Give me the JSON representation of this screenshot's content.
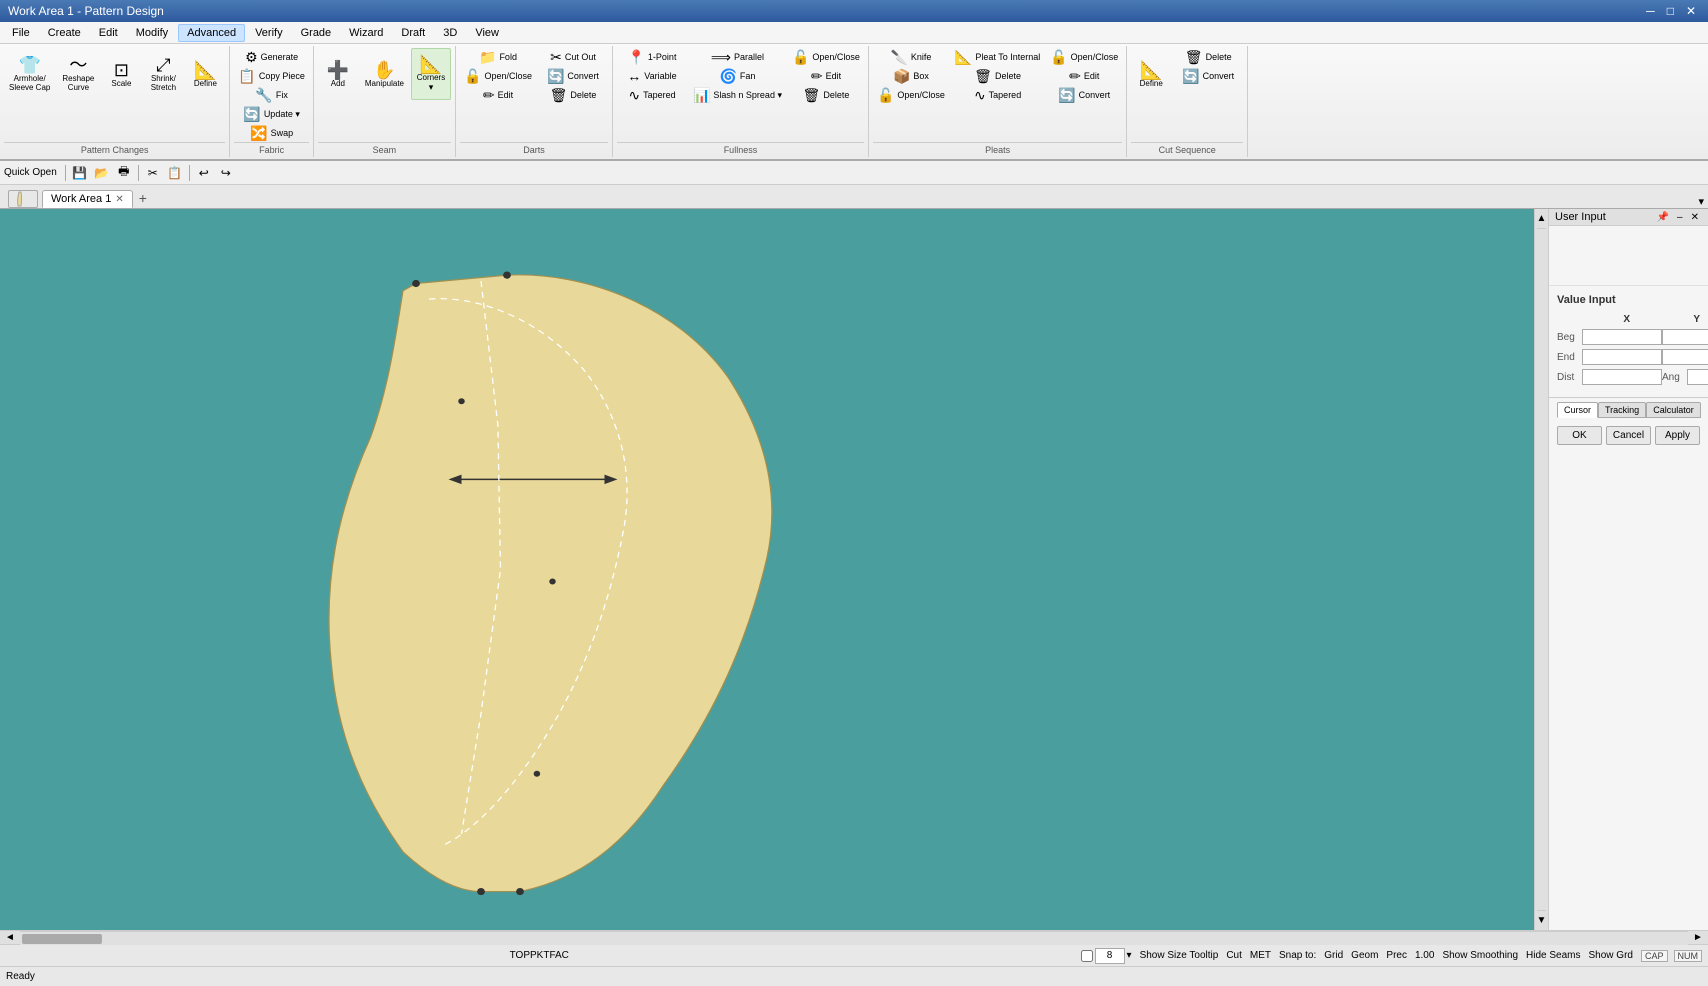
{
  "title_bar": {
    "title": "Work Area 1 - Pattern Design",
    "minimize": "─",
    "restore": "□",
    "close": "✕"
  },
  "menu": {
    "items": [
      "File",
      "Create",
      "Edit",
      "Modify",
      "Advanced",
      "Verify",
      "Grade",
      "Wizard",
      "Draft",
      "3D",
      "View"
    ]
  },
  "ribbon": {
    "groups": [
      {
        "label": "Pattern Changes",
        "buttons_large": [
          {
            "icon": "👕",
            "label": "Armhole/\nSleeve Cap"
          },
          {
            "icon": "〜",
            "label": "Reshape\nCurve"
          },
          {
            "icon": "⊞",
            "label": "Scale"
          },
          {
            "icon": "⤢",
            "label": "Shrink/\nStretch"
          },
          {
            "icon": "📐",
            "label": "Define"
          }
        ]
      },
      {
        "label": "Fabric",
        "buttons": [
          {
            "icon": "⚙",
            "label": "Generate",
            "type": "small"
          },
          {
            "icon": "📋",
            "label": "Copy Piece",
            "type": "small"
          },
          {
            "icon": "🔧",
            "label": "Fix",
            "type": "small"
          },
          {
            "icon": "🔄",
            "label": "Update ▾",
            "type": "small"
          },
          {
            "icon": "🔀",
            "label": "Swap",
            "type": "small"
          }
        ]
      },
      {
        "label": "Seam",
        "buttons": [
          {
            "icon": "➕",
            "label": "Add",
            "type": "large"
          },
          {
            "icon": "✋",
            "label": "Manipulate",
            "type": "large"
          },
          {
            "icon": "📐",
            "label": "Corners ▾",
            "type": "large"
          }
        ]
      },
      {
        "label": "Darts",
        "buttons": [
          {
            "icon": "📁",
            "label": "Fold",
            "type": "small"
          },
          {
            "icon": "🔓",
            "label": "Open/Close",
            "type": "small"
          },
          {
            "icon": "✂",
            "label": "Cut Out",
            "type": "small"
          },
          {
            "icon": "✏",
            "label": "Edit",
            "type": "small"
          },
          {
            "icon": "🔄",
            "label": "Convert",
            "type": "small"
          },
          {
            "icon": "🗑",
            "label": "Delete",
            "type": "small"
          }
        ]
      },
      {
        "label": "Fullness",
        "buttons": [
          {
            "icon": "📍",
            "label": "1-Point",
            "type": "small"
          },
          {
            "icon": "⟶",
            "label": "Variable",
            "type": "small"
          },
          {
            "icon": "🌊",
            "label": "Tapered",
            "type": "small"
          },
          {
            "icon": "⟷",
            "label": "Parallel",
            "type": "small"
          },
          {
            "icon": "🌀",
            "label": "Fan",
            "type": "small"
          },
          {
            "icon": "📊",
            "label": "Slash n Spread ▾",
            "type": "small"
          },
          {
            "icon": "🔓",
            "label": "Open/Close",
            "type": "small"
          },
          {
            "icon": "✏",
            "label": "Edit",
            "type": "small"
          },
          {
            "icon": "🗑",
            "label": "Delete",
            "type": "small"
          }
        ]
      },
      {
        "label": "Pleats",
        "buttons": [
          {
            "icon": "🔪",
            "label": "Knife",
            "type": "small"
          },
          {
            "icon": "📦",
            "label": "Box",
            "type": "small"
          },
          {
            "icon": "📁",
            "label": "Open/Close",
            "type": "small"
          },
          {
            "icon": "📐",
            "label": "Pleat To Internal",
            "type": "small"
          },
          {
            "icon": "🗑",
            "label": "Delete",
            "type": "small"
          },
          {
            "icon": "🌊",
            "label": "Tapered",
            "type": "small"
          },
          {
            "icon": "🔓",
            "label": "Open/Close",
            "type": "small"
          },
          {
            "icon": "✏",
            "label": "Edit",
            "type": "small"
          },
          {
            "icon": "🔄",
            "label": "Convert",
            "type": "small"
          }
        ]
      },
      {
        "label": "Cut Sequence",
        "buttons": [
          {
            "icon": "📐",
            "label": "Define",
            "type": "large"
          },
          {
            "icon": "🗑",
            "label": "Delete",
            "type": "small"
          },
          {
            "icon": "🔄",
            "label": "Convert",
            "type": "small"
          }
        ]
      }
    ],
    "corners_label": "Corners"
  },
  "toolbar": {
    "tools": [
      "💾",
      "📂",
      "🖶",
      "✂",
      "📋",
      "↩",
      "↪"
    ]
  },
  "tabs": {
    "active_tab": "Work Area 1",
    "tabs": [
      {
        "label": "Work Area 1",
        "closeable": true
      }
    ]
  },
  "canvas": {
    "pattern_label": "TOPPKTFAC",
    "bg_color": "#4a9e9e"
  },
  "right_panel": {
    "header": "User Input",
    "value_input": {
      "title": "Value Input",
      "col_beg": "Beg",
      "col_x": "X",
      "col_end": "End",
      "col_y": "Y",
      "col_dist": "Dist",
      "col_ang": "Ang"
    },
    "cursor_tabs": [
      "Cursor",
      "Tracking",
      "Calculator"
    ],
    "active_cursor_tab": "Cursor",
    "buttons": {
      "ok": "OK",
      "cancel": "Cancel",
      "apply": "Apply"
    }
  },
  "status_bar": {
    "left_status": "Quick Open",
    "ready": "Ready",
    "filename": "TOPPKTFAC",
    "zoom": "8",
    "show_size_tooltip": "Show Size Tooltip",
    "cut": "Cut",
    "met": "MET",
    "snap_to": "Snap to:",
    "grid": "Grid",
    "geom": "Geom",
    "prec": "Prec",
    "prec_value": "1.00",
    "show_smoothing": "Show Smoothing",
    "hide_seams": "Hide Seams",
    "show_grd": "Show Grd",
    "caps": "CAP",
    "num": "NUM"
  }
}
